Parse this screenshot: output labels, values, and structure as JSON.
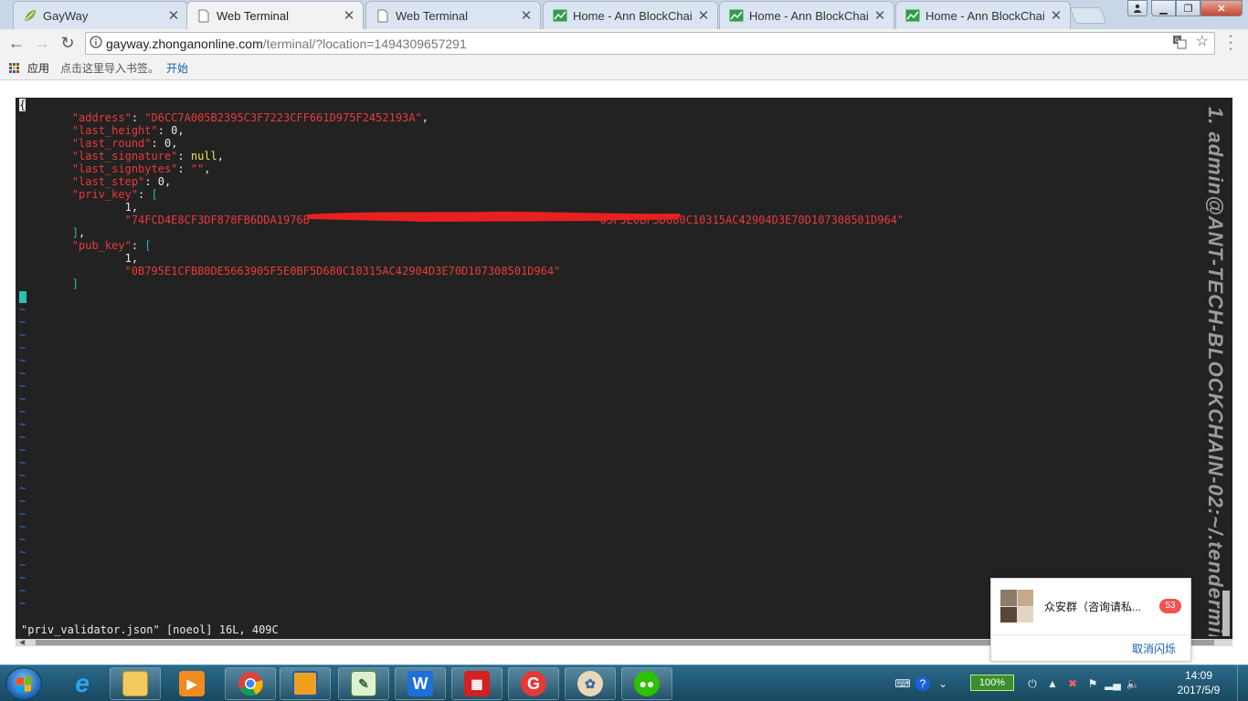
{
  "browser": {
    "tabs": [
      {
        "title": "GayWay",
        "icon": "leaf-icon",
        "active": false
      },
      {
        "title": "Web Terminal",
        "icon": "page-icon",
        "active": true
      },
      {
        "title": "Web Terminal",
        "icon": "page-icon",
        "active": false
      },
      {
        "title": "Home - Ann BlockChai",
        "icon": "chart-icon",
        "active": false
      },
      {
        "title": "Home - Ann BlockChai",
        "icon": "chart-icon",
        "active": false
      },
      {
        "title": "Home - Ann BlockChai",
        "icon": "chart-icon",
        "active": false
      }
    ],
    "url_host": "gayway.zhonganonline.com",
    "url_path": "/terminal/?location=1494309657291",
    "bookmarks": {
      "apps_label": "应用",
      "hint": "点击这里导入书签。",
      "start_link": "开始"
    }
  },
  "terminal": {
    "lines": [
      {
        "first_char": "{"
      },
      {
        "key": "\"address\"",
        "sep": ": ",
        "value": "\"D6CC7A005B2395C3F7223CFF661D975F2452193A\"",
        "tail": ","
      },
      {
        "key": "\"last_height\"",
        "sep": ": ",
        "value": "0",
        "tail": ","
      },
      {
        "key": "\"last_round\"",
        "sep": ": ",
        "value": "0",
        "tail": ","
      },
      {
        "key": "\"last_signature\"",
        "sep": ": ",
        "value": "null",
        "tail": ","
      },
      {
        "key": "\"last_signbytes\"",
        "sep": ": ",
        "value": "\"\"",
        "tail": ","
      },
      {
        "key": "\"last_step\"",
        "sep": ": ",
        "value": "0",
        "tail": ","
      },
      {
        "key": "\"priv_key\"",
        "sep": ": ",
        "bracket": "[",
        "tail": ""
      },
      {
        "value": "1",
        "tail": ","
      },
      {
        "value": "\"74FCD4E8CF3DF878FB6DDA1976B",
        "value2": "05F5E0BF5D680C10315AC42904D3E70D107308501D964\""
      },
      {
        "bracket": "]",
        "tail": ","
      },
      {
        "key": "\"pub_key\"",
        "sep": ": ",
        "bracket": "["
      },
      {
        "value": "1",
        "tail": ","
      },
      {
        "value": "\"0B795E1CFBB0DE5663905F5E0BF5D680C10315AC42904D3E70D107308501D964\""
      },
      {
        "bracket": "]"
      }
    ],
    "tilde": "~",
    "status": "\"priv_validator.json\" [noeol] 16L, 409C",
    "watermark": "1. admin@ANT-TECH-BLOCKCHAIN-02:~/.tendermint"
  },
  "notification": {
    "group_name": "众安群（咨询请私...",
    "count": "53",
    "cancel_label": "取消闪烁"
  },
  "taskbar": {
    "battery": "100%",
    "time": "14:09",
    "date": "2017/5/9"
  },
  "colors": {
    "terminal_bg": "#222222",
    "json_key": "#e83a3a",
    "json_string": "#e83a3a",
    "null": "#f0e85a",
    "bracket": "#2bb6b6",
    "tilde": "#3a6fd8",
    "redaction": "#e82020"
  }
}
